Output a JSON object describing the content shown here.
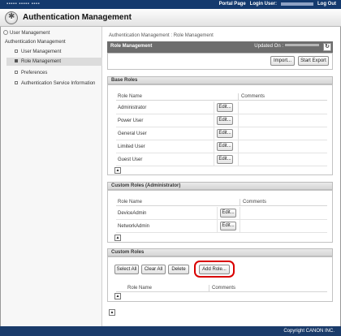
{
  "topbar": {
    "portal": "Portal Page",
    "login_user": "Login User:",
    "logout": "Log Out"
  },
  "app": {
    "title": "Authentication Management"
  },
  "sidebar": {
    "user_management": "User Management",
    "auth_management": "Authentication Management",
    "items": [
      {
        "label": "User Management"
      },
      {
        "label": "Role Management"
      },
      {
        "label": "Preferences"
      },
      {
        "label": "Authentication Service Information"
      }
    ]
  },
  "breadcrumb": "Authentication Management : Role Management",
  "main": {
    "title": "Role Management",
    "updated_label": "Updated On :",
    "import": "Import...",
    "start_export": "Start Export"
  },
  "base_roles": {
    "title": "Base Roles",
    "col_name": "Role Name",
    "col_comments": "Comments",
    "edit": "Edit...",
    "rows": [
      "Administrator",
      "Power User",
      "General User",
      "Limited User",
      "Guest User"
    ]
  },
  "custom_admin": {
    "title": "Custom Roles (Administrator)",
    "col_name": "Role Name",
    "col_comments": "Comments",
    "edit": "Edit...",
    "rows": [
      "DeviceAdmin",
      "NetworkAdmin"
    ]
  },
  "custom_roles": {
    "title": "Custom Roles",
    "select_all": "Select All",
    "clear_all": "Clear All",
    "delete": "Delete",
    "add_role": "Add Role...",
    "col_name": "Role Name",
    "col_comments": "Comments"
  },
  "footer": {
    "copyright": "Copyright CANON INC."
  },
  "colors": {
    "header_blue": "#143a6e",
    "highlight_red": "#d90000"
  }
}
